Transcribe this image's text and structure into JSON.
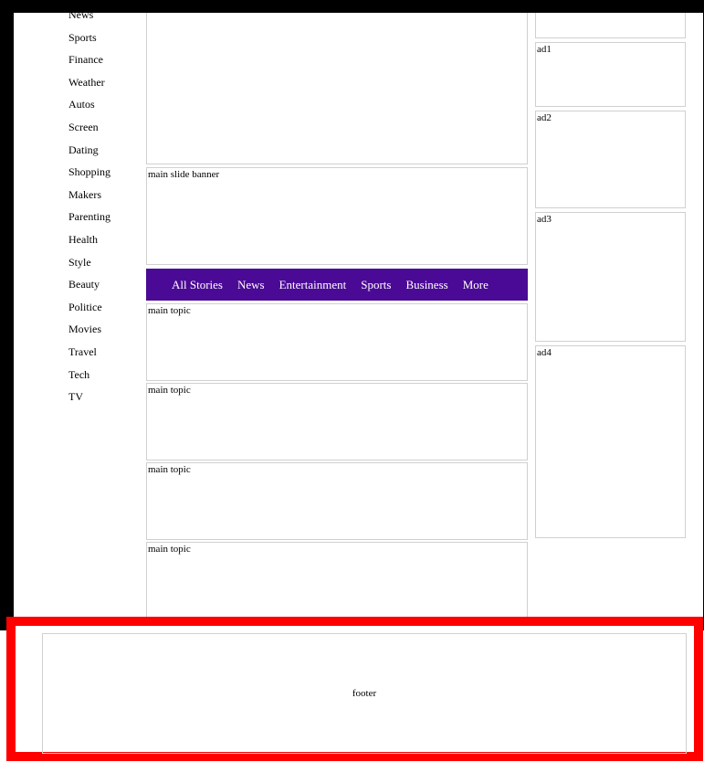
{
  "sidebar": {
    "items": [
      "News",
      "Sports",
      "Finance",
      "Weather",
      "Autos",
      "Screen",
      "Dating",
      "Shopping",
      "Makers",
      "Parenting",
      "Health",
      "Style",
      "Beauty",
      "Politice",
      "Movies",
      "Travel",
      "Tech",
      "TV"
    ]
  },
  "main": {
    "slide_banner": "main slide banner",
    "story_tabs": [
      "All Stories",
      "News",
      "Entertainment",
      "Sports",
      "Business",
      "More"
    ],
    "topics": [
      "main topic",
      "main topic",
      "main topic",
      "main topic"
    ]
  },
  "ads": [
    "ad1",
    "ad2",
    "ad3",
    "ad4"
  ],
  "footer": {
    "label": "footer"
  },
  "colors": {
    "story_bar": "#4b0a95",
    "highlight": "#ff0000",
    "border": "#000000"
  }
}
